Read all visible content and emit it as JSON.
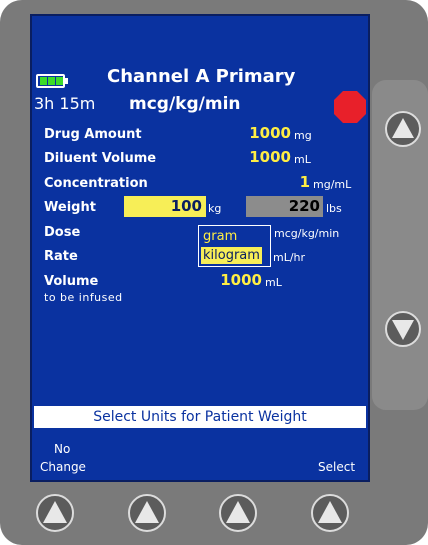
{
  "header": {
    "channel_title": "Channel A Primary",
    "time_remaining": "3h 15m",
    "dose_units": "mcg/kg/min",
    "battery_level": 1.0
  },
  "parameters": {
    "drug_amount": {
      "label": "Drug Amount",
      "value": "1000",
      "unit": "mg"
    },
    "diluent_volume": {
      "label": "Diluent Volume",
      "value": "1000",
      "unit": "mL"
    },
    "concentration": {
      "label": "Concentration",
      "value": "1",
      "unit": "mg/mL"
    },
    "weight": {
      "label": "Weight",
      "value_kg": "100",
      "unit_kg": "kg",
      "value_lbs": "220",
      "unit_lbs": "lbs"
    },
    "dose": {
      "label": "Dose",
      "unit": "mcg/kg/min"
    },
    "rate": {
      "label": "Rate",
      "unit": "mL/hr"
    },
    "volume": {
      "label": "Volume",
      "sublabel": "to be infused",
      "value": "1000",
      "unit": "mL"
    }
  },
  "units_dropdown": {
    "options": [
      "gram",
      "kilogram"
    ],
    "selected": "kilogram"
  },
  "prompt": "Select Units for Patient Weight",
  "softkeys": {
    "left_line1": "No",
    "left_line2": "Change",
    "right": "Select"
  },
  "colors": {
    "screen_bg": "#0a32a0",
    "value_yellow": "#ffee44",
    "highlight": "#f7ee57",
    "stop_red": "#e8202a",
    "battery_green": "#3ddc2a"
  }
}
